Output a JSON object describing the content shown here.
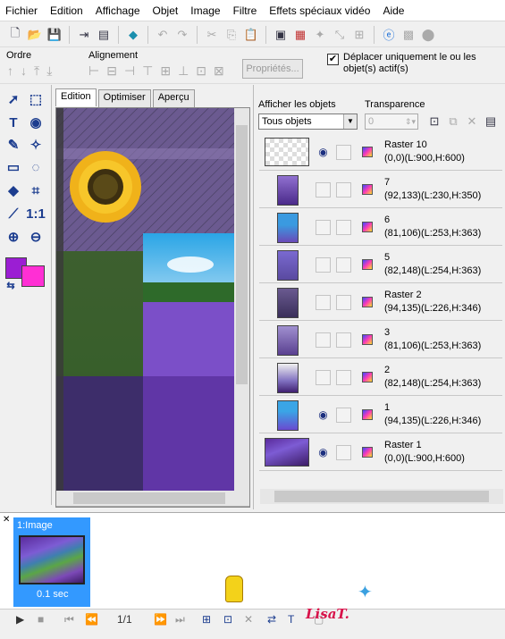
{
  "menu": [
    "Fichier",
    "Edition",
    "Affichage",
    "Objet",
    "Image",
    "Filtre",
    "Effets spéciaux vidéo",
    "Aide"
  ],
  "toolbar": {
    "order_label": "Ordre",
    "alignment_label": "Alignement",
    "properties_label": "Propriétés...",
    "move_active_only_label": "Déplacer uniquement le ou les objet(s) actif(s)",
    "move_active_only_checked": "✔"
  },
  "editor_tabs": [
    "Edition",
    "Optimiser",
    "Aperçu"
  ],
  "objects_panel": {
    "show_objects_label": "Afficher les objets",
    "transparency_label": "Transparence",
    "filter_value": "Tous objets",
    "transparency_value": "0",
    "layers": [
      {
        "name": "Raster 10",
        "info": "(0,0)(L:900,H:600)",
        "visible": true
      },
      {
        "name": "7",
        "info": "(92,133)(L:230,H:350)",
        "visible": false
      },
      {
        "name": "6",
        "info": "(81,106)(L:253,H:363)",
        "visible": false
      },
      {
        "name": "5",
        "info": "(82,148)(L:254,H:363)",
        "visible": false
      },
      {
        "name": "Raster 2",
        "info": "(94,135)(L:226,H:346)",
        "visible": false
      },
      {
        "name": "3",
        "info": "(81,106)(L:253,H:363)",
        "visible": false
      },
      {
        "name": "2",
        "info": "(82,148)(L:254,H:363)",
        "visible": false
      },
      {
        "name": "1",
        "info": "(94,135)(L:226,H:346)",
        "visible": true
      },
      {
        "name": "Raster 1",
        "info": "(0,0)(L:900,H:600)",
        "visible": true
      }
    ]
  },
  "animation": {
    "frame_label": "1:Image",
    "frame_duration": "0.1 sec",
    "frame_counter": "1/1"
  },
  "colors": {
    "foreground": "#9b1ed3",
    "background": "#ff2fd4",
    "selection": "#3399ff"
  },
  "signature": "LisaT."
}
